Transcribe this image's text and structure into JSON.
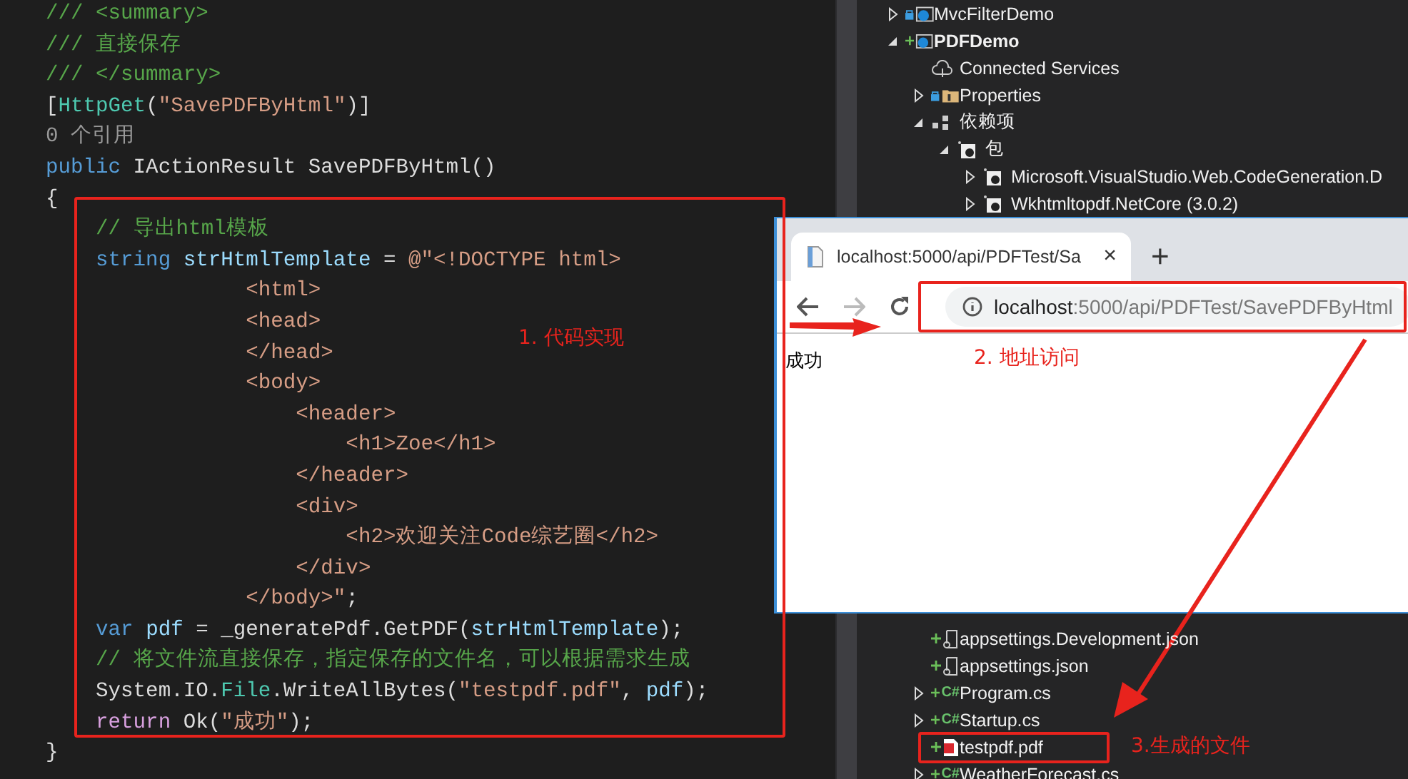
{
  "editor": {
    "lines": [
      {
        "tokens": [
          {
            "text": "/// <summary>",
            "kind": "comment"
          }
        ]
      },
      {
        "tokens": [
          {
            "text": "/// 直接保存",
            "kind": "comment"
          }
        ]
      },
      {
        "tokens": [
          {
            "text": "/// </summary>",
            "kind": "comment"
          }
        ]
      },
      {
        "tokens": [
          {
            "text": "[",
            "kind": "plain"
          },
          {
            "text": "HttpGet",
            "kind": "type"
          },
          {
            "text": "(",
            "kind": "plain"
          },
          {
            "text": "\"SavePDFByHtml\"",
            "kind": "string"
          },
          {
            "text": ")]",
            "kind": "plain"
          }
        ]
      },
      {
        "tokens": [
          {
            "text": "0 个引用",
            "kind": "lens"
          }
        ]
      },
      {
        "tokens": [
          {
            "text": "public",
            "kind": "keyword"
          },
          {
            "text": " IActionResult SavePDFByHtml()",
            "kind": "plain"
          }
        ]
      },
      {
        "tokens": [
          {
            "text": "{",
            "kind": "plain"
          }
        ]
      },
      {
        "tokens": [
          {
            "text": "    // 导出html模板",
            "kind": "comment"
          }
        ]
      },
      {
        "tokens": [
          {
            "text": "    string",
            "kind": "keyword"
          },
          {
            "text": " strHtmlTemplate",
            "kind": "variable"
          },
          {
            "text": " = ",
            "kind": "plain"
          },
          {
            "text": "@\"<!DOCTYPE html>",
            "kind": "string"
          }
        ]
      },
      {
        "tokens": [
          {
            "text": "                <html>",
            "kind": "string"
          }
        ]
      },
      {
        "tokens": [
          {
            "text": "                <head>",
            "kind": "string"
          }
        ]
      },
      {
        "tokens": [
          {
            "text": "                </head>",
            "kind": "string"
          }
        ]
      },
      {
        "tokens": [
          {
            "text": "                <body>",
            "kind": "string"
          }
        ]
      },
      {
        "tokens": [
          {
            "text": "                    <header>",
            "kind": "string"
          }
        ]
      },
      {
        "tokens": [
          {
            "text": "                        <h1>Zoe</h1>",
            "kind": "string"
          }
        ]
      },
      {
        "tokens": [
          {
            "text": "                    </header>",
            "kind": "string"
          }
        ]
      },
      {
        "tokens": [
          {
            "text": "                    <div>",
            "kind": "string"
          }
        ]
      },
      {
        "tokens": [
          {
            "text": "                        <h2>欢迎关注Code综艺圈</h2>",
            "kind": "string"
          }
        ]
      },
      {
        "tokens": [
          {
            "text": "                    </div>",
            "kind": "string"
          }
        ]
      },
      {
        "tokens": [
          {
            "text": "                </body>\"",
            "kind": "string"
          },
          {
            "text": ";",
            "kind": "plain"
          }
        ]
      },
      {
        "tokens": [
          {
            "text": "    var",
            "kind": "keyword"
          },
          {
            "text": " pdf",
            "kind": "variable"
          },
          {
            "text": " = _generatePdf.GetPDF(",
            "kind": "plain"
          },
          {
            "text": "strHtmlTemplate",
            "kind": "variable"
          },
          {
            "text": ");",
            "kind": "plain"
          }
        ]
      },
      {
        "tokens": [
          {
            "text": "    // 将文件流直接保存，指定保存的文件名，可以根据需求生成",
            "kind": "comment"
          }
        ]
      },
      {
        "tokens": [
          {
            "text": "    System.IO.",
            "kind": "plain"
          },
          {
            "text": "File",
            "kind": "type"
          },
          {
            "text": ".WriteAllBytes(",
            "kind": "plain"
          },
          {
            "text": "\"testpdf.pdf\"",
            "kind": "string"
          },
          {
            "text": ", ",
            "kind": "plain"
          },
          {
            "text": "pdf",
            "kind": "variable"
          },
          {
            "text": ");",
            "kind": "plain"
          }
        ]
      },
      {
        "tokens": [
          {
            "text": "    return",
            "kind": "control"
          },
          {
            "text": " Ok(",
            "kind": "plain"
          },
          {
            "text": "\"成功\"",
            "kind": "string"
          },
          {
            "text": ");",
            "kind": "plain"
          }
        ]
      },
      {
        "tokens": [
          {
            "text": "}",
            "kind": "plain"
          }
        ]
      }
    ]
  },
  "solution_explorer": {
    "items": [
      {
        "label": "MvcFilterDemo",
        "kind": "project",
        "locked": true,
        "added": false,
        "expanded": false
      },
      {
        "label": "PDFDemo",
        "kind": "project",
        "locked": false,
        "added": true,
        "expanded": true,
        "children": [
          {
            "label": "Connected Services",
            "kind": "cloud",
            "locked": false,
            "added": false
          },
          {
            "label": "Properties",
            "kind": "folder",
            "locked": true,
            "added": false,
            "expanded": false
          },
          {
            "label": "依赖项",
            "kind": "dependencies",
            "locked": false,
            "added": false,
            "expanded": true,
            "children": [
              {
                "label": "包",
                "kind": "package",
                "locked": false,
                "added": false,
                "expanded": true,
                "children": [
                  {
                    "label": "Microsoft.VisualStudio.Web.CodeGeneration.D",
                    "kind": "package",
                    "locked": false,
                    "added": false,
                    "expanded": false
                  },
                  {
                    "label": "Wkhtmltopdf.NetCore (3.0.2)",
                    "kind": "package",
                    "locked": false,
                    "added": false,
                    "expanded": false
                  }
                ]
              }
            ]
          },
          {
            "label": "appsettings.Development.json",
            "kind": "json",
            "locked": false,
            "added": true
          },
          {
            "label": "appsettings.json",
            "kind": "json",
            "locked": false,
            "added": true
          },
          {
            "label": "Program.cs",
            "kind": "csharp",
            "icon_text": "C#",
            "locked": false,
            "added": true,
            "expanded": false
          },
          {
            "label": "Startup.cs",
            "kind": "csharp",
            "icon_text": "C#",
            "locked": false,
            "added": true,
            "expanded": false
          },
          {
            "label": "testpdf.pdf",
            "kind": "pdf",
            "locked": false,
            "added": true
          },
          {
            "label": "WeatherForecast.cs",
            "kind": "csharp",
            "icon_text": "C#",
            "locked": false,
            "added": true,
            "expanded": false
          }
        ]
      }
    ]
  },
  "browser": {
    "tab_title": "localhost:5000/api/PDFTest/Sa",
    "close": "×",
    "new_tab": "+",
    "address_host": "localhost",
    "address_path": ":5000/api/PDFTest/SavePDFByHtml",
    "page_text": "成功"
  },
  "annotations": {
    "code_label": "1. 代码实现",
    "address_label": "2. 地址访问",
    "file_label": "3.生成的文件"
  }
}
